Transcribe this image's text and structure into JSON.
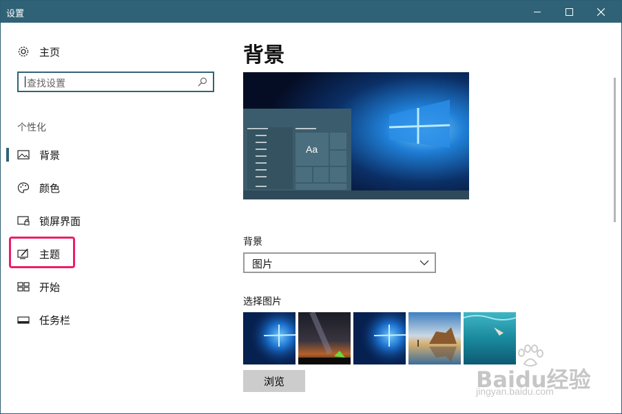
{
  "window": {
    "title": "设置"
  },
  "sidebar": {
    "home_label": "主页",
    "search_placeholder": "查找设置",
    "section_title": "个性化",
    "items": [
      {
        "label": "背景",
        "icon": "picture-icon",
        "active": true
      },
      {
        "label": "颜色",
        "icon": "palette-icon",
        "active": false
      },
      {
        "label": "锁屏界面",
        "icon": "lock-screen-icon",
        "active": false
      },
      {
        "label": "主题",
        "icon": "theme-icon",
        "active": false
      },
      {
        "label": "开始",
        "icon": "start-icon",
        "active": false
      },
      {
        "label": "任务栏",
        "icon": "taskbar-icon",
        "active": false
      }
    ]
  },
  "main": {
    "page_title": "背景",
    "preview": {
      "sample_text": "Aa"
    },
    "background_label": "背景",
    "background_value": "图片",
    "choose_picture_label": "选择图片",
    "thumbnails": [
      "windows-hero-1",
      "milky-way-tent",
      "windows-hero-2",
      "beach-rocks",
      "underwater-swimmer"
    ],
    "browse_label": "浏览"
  },
  "watermark": {
    "brand": "Baidu经验",
    "url": "jingyan.baidu.com"
  },
  "colors": {
    "titlebar": "#2f6276",
    "highlight": "#ee1b67",
    "accent": "#2f6276"
  }
}
